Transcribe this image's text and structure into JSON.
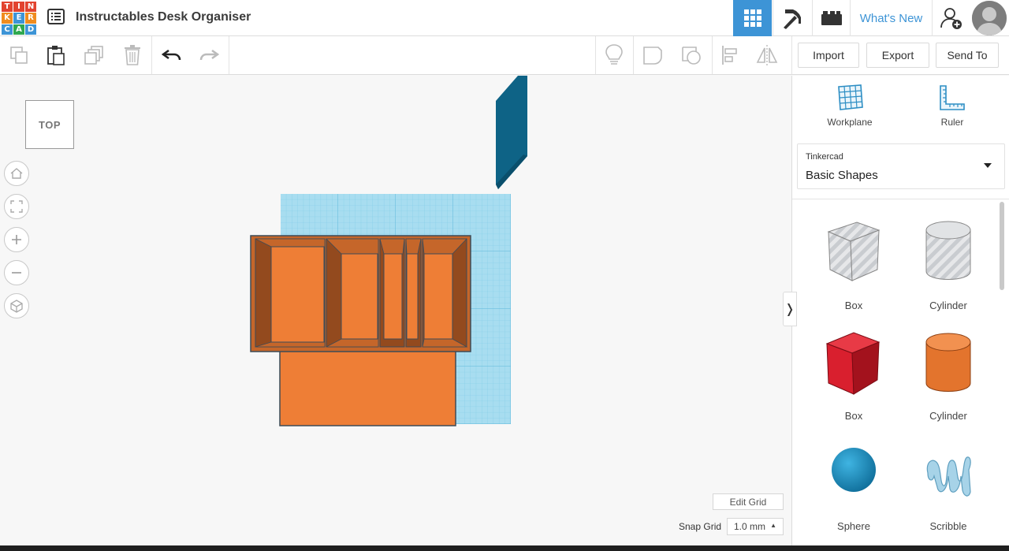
{
  "app": {
    "logo_letters": [
      "T",
      "I",
      "N",
      "K",
      "E",
      "R",
      "C",
      "A",
      "D"
    ],
    "logo_colors": [
      "#e2432f",
      "#e2432f",
      "#e2432f",
      "#f08c1f",
      "#3d94d6",
      "#f08c1f",
      "#3d94d6",
      "#2fa84f",
      "#3d94d6"
    ],
    "doc_icon": "list-icon",
    "title": "Instructables Desk Organiser"
  },
  "nav": {
    "grid_icon": "grid-view-icon",
    "pickaxe_icon": "pickaxe-icon",
    "bricks_icon": "bricks-icon",
    "whats_new": "What's New",
    "adduser_icon": "add-user-icon",
    "avatar_icon": "avatar-icon",
    "active_color": "#3d94d6"
  },
  "toolbar": {
    "icons": [
      "copy-icon",
      "paste-icon",
      "duplicate-icon",
      "delete-icon",
      "undo-icon",
      "redo-icon",
      "hint-icon",
      "group-icon",
      "ungroup-icon",
      "align-icon",
      "mirror-icon"
    ],
    "import_label": "Import",
    "export_label": "Export",
    "sendto_label": "Send To"
  },
  "canvas": {
    "viewcube_label": "TOP",
    "nav_controls": [
      "home-icon",
      "fit-view-icon",
      "zoom-in-icon",
      "zoom-out-icon",
      "perspective-icon"
    ],
    "edit_grid_label": "Edit Grid",
    "snap_grid_label": "Snap Grid",
    "snap_grid_value": "1.0 mm",
    "colors": {
      "workplane": "#a8ddf0",
      "workplane_line": "#7fcbe6",
      "orange": "#ee7e36",
      "orange_dark": "#c5662a",
      "orange_side": "#934a1e",
      "teal": "#0e6386",
      "outline": "#3d4b57"
    }
  },
  "panel": {
    "collapse_glyph": "❭",
    "workplane_label": "Workplane",
    "ruler_label": "Ruler",
    "library_brand": "Tinkercad",
    "library_name": "Basic Shapes",
    "shapes": [
      {
        "label": "Box",
        "icon": "box-hole-icon"
      },
      {
        "label": "Cylinder",
        "icon": "cylinder-hole-icon"
      },
      {
        "label": "Box",
        "icon": "box-solid-icon",
        "color": "#d91f2e"
      },
      {
        "label": "Cylinder",
        "icon": "cylinder-solid-icon",
        "color": "#ee7e36"
      },
      {
        "label": "Sphere",
        "icon": "sphere-icon",
        "color": "#1f95c9"
      },
      {
        "label": "Scribble",
        "icon": "scribble-icon",
        "color": "#8fc6de"
      }
    ]
  }
}
